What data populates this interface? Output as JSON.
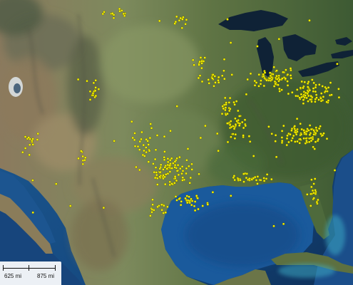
{
  "map": {
    "basemap": "satellite-imagery",
    "marker_color": "#f4f000",
    "marker_outline": "#2a2a00",
    "colors": {
      "deep_ocean": "#0f2f57",
      "ocean": "#1b4f8d",
      "shallow_water": "#2a88b0",
      "lake": "#0f2236",
      "plains": "#7b8e5a",
      "forest_east": "#3f5a33",
      "desert": "#9a8a6a",
      "mountains": "#6d6a59"
    },
    "marker_regions": [
      "northern-plains",
      "front-range",
      "southwest",
      "texas",
      "gulf-coast",
      "florida",
      "midwest",
      "great-lakes",
      "ohio-valley",
      "southeast"
    ]
  },
  "scale": {
    "label_left": "625 mi",
    "label_right": "875 mi",
    "icon": "scale-bar-icon"
  }
}
